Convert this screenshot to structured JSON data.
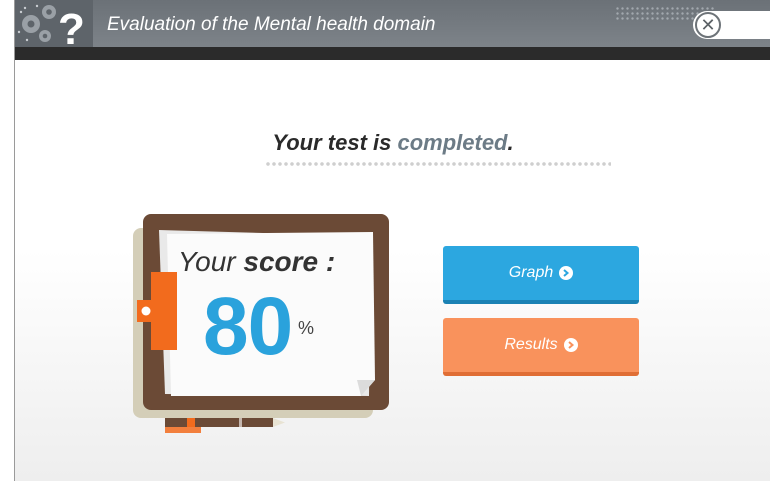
{
  "header": {
    "title": "Evaluation of the Mental health domain",
    "logo_icon": "gears-question-icon",
    "close_label": "✕"
  },
  "main": {
    "completed_prefix": "Your test is ",
    "completed_highlight": "completed",
    "completed_suffix": ".",
    "score_label_prefix": "Your ",
    "score_label_bold": "score :",
    "score_value": "80",
    "score_unit": "%",
    "clipboard_icon": "clipboard-icon",
    "pen_icon": "pen-icon"
  },
  "buttons": {
    "graph_label": "Graph",
    "results_label": "Results",
    "arrow_icon": "circle-arrow-right-icon"
  },
  "colors": {
    "header": "#737980",
    "graph_button": "#2ca7e0",
    "results_button": "#f9925c",
    "score": "#2aa2dc",
    "highlight": "#6c7b86"
  }
}
